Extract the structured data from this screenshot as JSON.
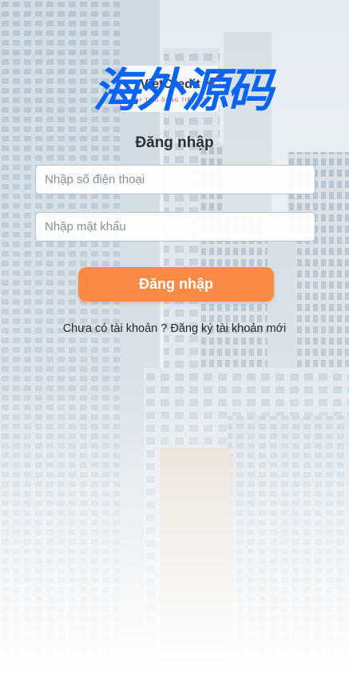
{
  "brand": {
    "logo_text": "VietCredit",
    "logo_tagline": "VAY TIÊU DÙNG TIỆN LỢI",
    "watermark_text": "海外源码",
    "watermark_color": "#0b63f2",
    "check_color": "#d12b3a"
  },
  "login": {
    "title": "Đăng nhập",
    "phone_placeholder": "Nhập số điện thoại",
    "password_placeholder": "Nhập mật khẩu",
    "submit_label": "Đăng nhập",
    "signup_prompt": "Chưa có tài khoản ?",
    "signup_link": "Đăng ký tài khoản mới"
  },
  "colors": {
    "button": "#fb8a47",
    "background": "#f4f7fa"
  }
}
